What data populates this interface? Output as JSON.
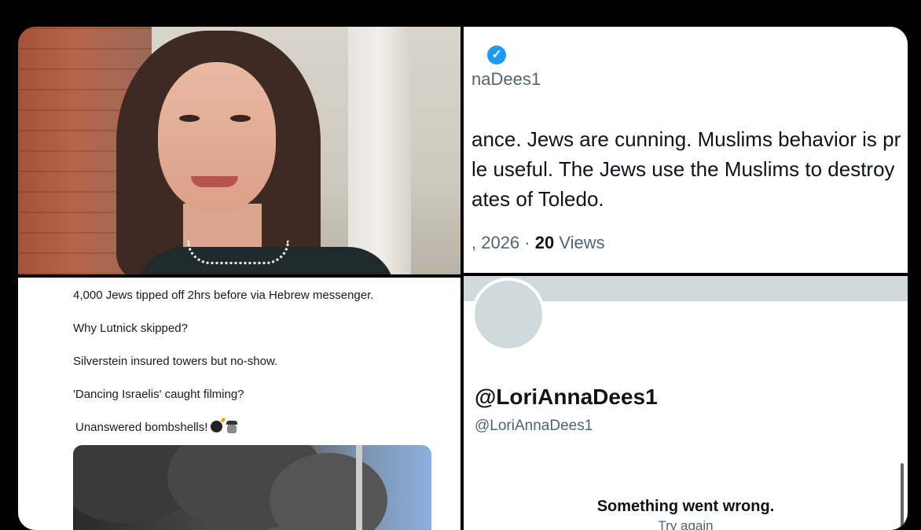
{
  "tweet": {
    "handle_partial": "naDees1",
    "lines": [
      "ance. Jews are cunning. Muslims behavior is pr",
      "le useful. The Jews use the Muslims to destroy",
      "ates of Toledo."
    ],
    "date_partial": ", 2026 · ",
    "views_count": "20",
    "views_label": "Views"
  },
  "post": {
    "lines": [
      "4,000 Jews tipped off 2hrs before via Hebrew messenger.",
      "Why Lutnick skipped?",
      "Silverstein insured towers but no-show.",
      "'Dancing Israelis' caught filming?",
      "Unanswered bombshells!"
    ]
  },
  "profile": {
    "name": "@LoriAnnaDees1",
    "handle": "@LoriAnnaDees1",
    "error_title": "Something went wrong.",
    "retry_label": "Try again"
  },
  "icons": {
    "verified": "verified-badge-icon",
    "bomb": "bomb-emoji",
    "spy": "detective-emoji"
  },
  "colors": {
    "verified_blue": "#1d9bf0",
    "muted_text": "#536471",
    "primary_text": "#0f1419"
  }
}
